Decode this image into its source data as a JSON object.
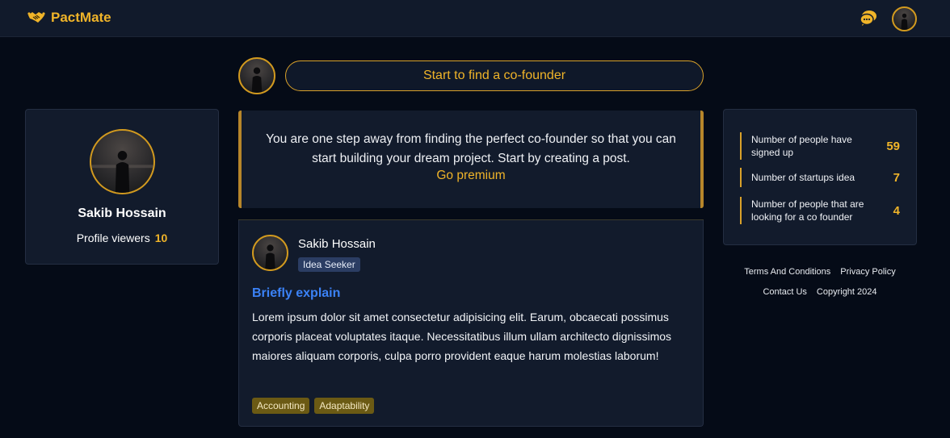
{
  "colors": {
    "accent": "#f0b429",
    "background": "#050b17",
    "card": "#121b2c",
    "link_blue": "#3b82f6",
    "tag_bg": "#6b5a14",
    "role_badge_bg": "#2b3d63"
  },
  "navbar": {
    "brand_name": "PactMate",
    "logo_icon": "handshake-icon",
    "chat_icon": "chat-bubbles-icon",
    "avatar_icon": "user-avatar"
  },
  "composer": {
    "button_label": "Start to find a co-founder"
  },
  "profile": {
    "name": "Sakib Hossain",
    "viewers_label": "Profile viewers",
    "viewers_count": "10"
  },
  "info": {
    "message": "You are one step away from finding the perfect co-founder so that you can start building your dream project. Start by creating a post.",
    "premium_link": "Go premium"
  },
  "post": {
    "author": "Sakib Hossain",
    "role": "Idea Seeker",
    "title": "Briefly explain",
    "body": "Lorem ipsum dolor sit amet consectetur adipisicing elit. Earum, obcaecati possimus corporis placeat voluptates itaque. Necessitatibus illum ullam architecto dignissimos maiores aliquam corporis, culpa porro provident eaque harum molestias laborum!",
    "tags": [
      "Accounting",
      "Adaptability"
    ]
  },
  "stats": [
    {
      "label": "Number of people have signed up",
      "value": "59"
    },
    {
      "label": "Number of startups idea",
      "value": "7"
    },
    {
      "label": "Number of people that are looking for a co founder",
      "value": "4"
    }
  ],
  "footer": {
    "terms": "Terms And Conditions",
    "privacy": "Privacy Policy",
    "contact": "Contact Us",
    "copyright": "Copyright 2024"
  }
}
